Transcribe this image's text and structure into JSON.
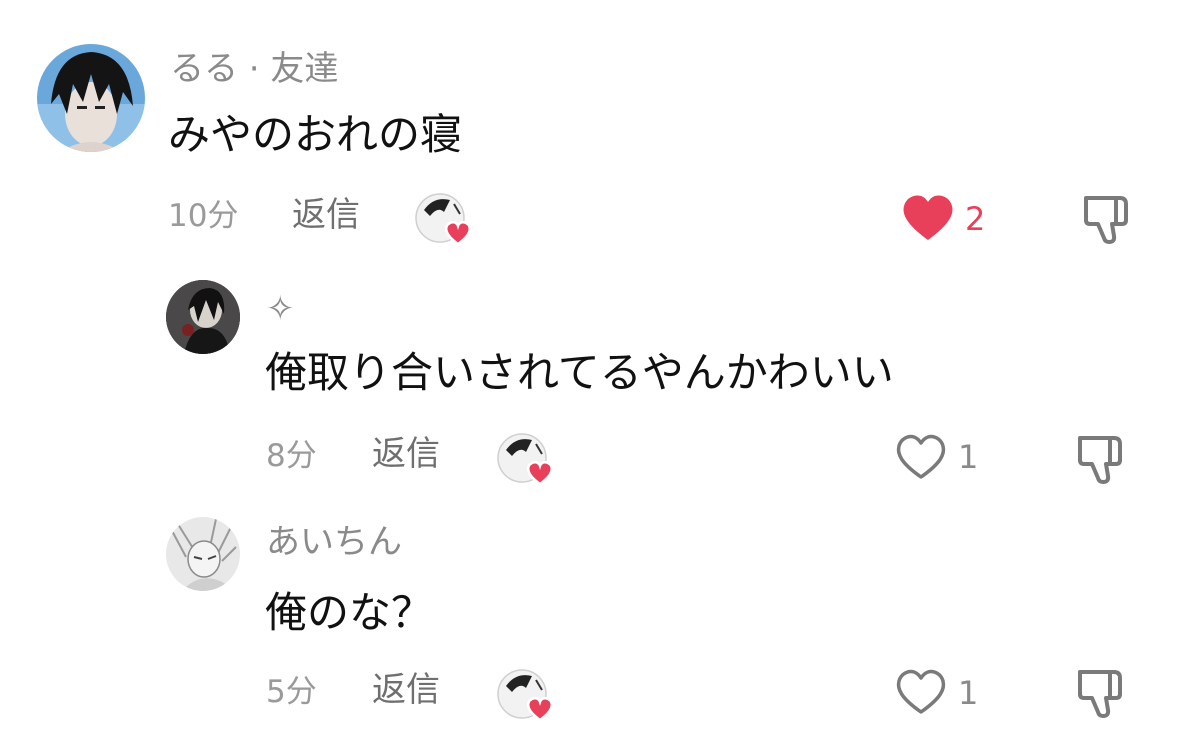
{
  "colors": {
    "like_active": "#e8405a",
    "muted_text": "#8a8a8a",
    "icon_stroke": "#7a7a7a"
  },
  "comments": [
    {
      "username": "るる · 友達",
      "text": "みやのおれの寝",
      "time": "10分",
      "reply_label": "返信",
      "like_count": "2",
      "liked": true,
      "avatar_icon": "user-avatar-icon"
    },
    {
      "username": "✧",
      "text": "俺取り合いされてるやんかわいい",
      "time": "8分",
      "reply_label": "返信",
      "like_count": "1",
      "liked": false,
      "avatar_icon": "user-avatar-icon"
    },
    {
      "username": "あいちん",
      "text": "俺のな？",
      "time": "5分",
      "reply_label": "返信",
      "like_count": "1",
      "liked": false,
      "avatar_icon": "user-avatar-icon"
    }
  ]
}
